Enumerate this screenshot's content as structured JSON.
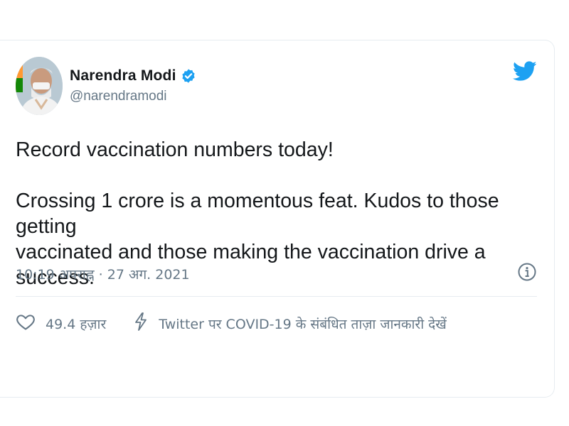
{
  "tweet": {
    "author": {
      "display_name": "Narendra Modi",
      "handle": "@narendramodi",
      "verified": true,
      "avatar": "profile-photo"
    },
    "platform_icon": "twitter-bird-icon",
    "text": {
      "line1": "Record vaccination numbers today!",
      "para2_line1": "Crossing 1 crore is a momentous feat. Kudos to those getting",
      "para2_line2": "vaccinated and those making the vaccination drive a success."
    },
    "timestamp": "10:19 अपराह्न · 27 अग. 2021",
    "info_icon": "info-icon",
    "actions": {
      "like_icon": "heart-icon",
      "like_count": "49.4 हज़ार",
      "covid_icon": "lightning-icon",
      "covid_label": "Twitter पर COVID-19 के संबंधित ताज़ा जानकारी देखें"
    }
  },
  "colors": {
    "text_primary": "#14171a",
    "text_secondary": "#657786",
    "twitter_blue": "#1da1f2",
    "border": "#e6ecf0"
  }
}
